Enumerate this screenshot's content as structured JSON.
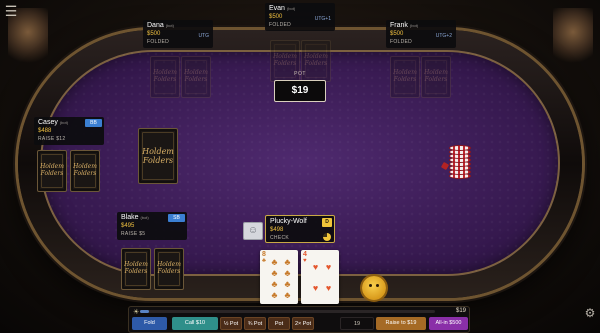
{
  "menu_icon": "hamburger-menu-icon",
  "settings_icon": "gear-icon",
  "pot": {
    "label": "POT",
    "value": "$19"
  },
  "players": {
    "dana": {
      "name": "Dana",
      "tag": "(bot)",
      "chips": "$500",
      "status": "FOLDED",
      "position": "UTG"
    },
    "evan": {
      "name": "Evan",
      "tag": "(bot)",
      "chips": "$500",
      "status": "FOLDED",
      "position": "UTG+1"
    },
    "frank": {
      "name": "Frank",
      "tag": "(bot)",
      "chips": "$500",
      "status": "FOLDED",
      "position": "UTG+2"
    },
    "casey": {
      "name": "Casey",
      "tag": "(bot)",
      "chips": "$488",
      "status": "RAISE  $12",
      "badge": "BB"
    },
    "blake": {
      "name": "Blake",
      "tag": "(bot)",
      "chips": "$495",
      "status": "RAISE  $5",
      "badge": "SB"
    },
    "hero": {
      "name": "Plucky-Wolf",
      "chips": "$498",
      "status": "CHECK",
      "badge": "D"
    }
  },
  "card_back_logo": "Holdem Folders",
  "hero_cards": [
    {
      "rank": "8",
      "suit": "clubs",
      "symbol": "♣"
    },
    {
      "rank": "4",
      "suit": "hearts",
      "symbol": "♥"
    }
  ],
  "colors": {
    "felt": "#3b1c55",
    "accent_gold": "#f0c040",
    "fold": "#2e5aa8",
    "call": "#2f8f8a",
    "raise": "#a56a25",
    "allin": "#8a2fa8"
  },
  "controls": {
    "slider_max_label": "$19",
    "slider_fraction": 0.0,
    "fold": "Fold",
    "call": "Call  $10",
    "bet_half": "½ Pot",
    "bet_three_quarter": "¾ Pot",
    "bet_pot": "Pot",
    "bet_two_pot": "2× Pot",
    "amount": "19",
    "raise": "Raise to  $19",
    "allin": "All-in  $500"
  }
}
